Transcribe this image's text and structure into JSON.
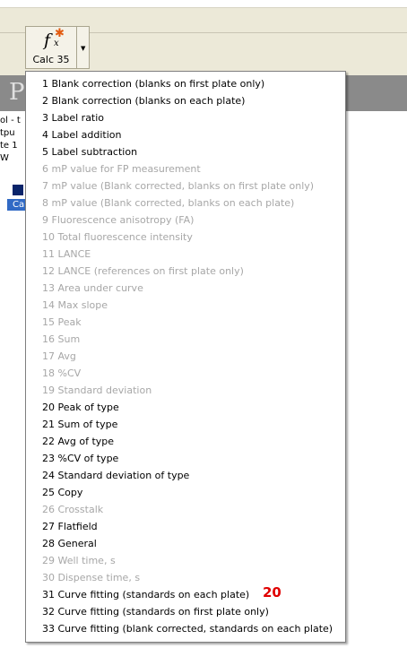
{
  "toolbar": {
    "calc_button_label": "Calc 35"
  },
  "background_window": {
    "header_letter": "P",
    "lines": [
      "ol - t",
      "tpu",
      "te 1",
      "  W"
    ],
    "selected_row_text": "Ca"
  },
  "menu": {
    "items": [
      {
        "label": "1 Blank correction (blanks on first plate only)",
        "enabled": true
      },
      {
        "label": "2 Blank correction (blanks on each plate)",
        "enabled": true
      },
      {
        "label": "3 Label ratio",
        "enabled": true
      },
      {
        "label": "4 Label addition",
        "enabled": true
      },
      {
        "label": "5 Label subtraction",
        "enabled": true
      },
      {
        "label": "6 mP value for FP measurement",
        "enabled": false
      },
      {
        "label": "7 mP value (Blank corrected, blanks on first plate only)",
        "enabled": false
      },
      {
        "label": "8 mP value (Blank corrected, blanks on each plate)",
        "enabled": false
      },
      {
        "label": "9 Fluorescence anisotropy (FA)",
        "enabled": false
      },
      {
        "label": "10 Total fluorescence intensity",
        "enabled": false
      },
      {
        "label": "11 LANCE",
        "enabled": false
      },
      {
        "label": "12 LANCE (references on first plate only)",
        "enabled": false
      },
      {
        "label": "13 Area under curve",
        "enabled": false
      },
      {
        "label": "14 Max slope",
        "enabled": false
      },
      {
        "label": "15 Peak",
        "enabled": false
      },
      {
        "label": "16 Sum",
        "enabled": false
      },
      {
        "label": "17 Avg",
        "enabled": false
      },
      {
        "label": "18 %CV",
        "enabled": false
      },
      {
        "label": "19 Standard deviation",
        "enabled": false
      },
      {
        "label": "20 Peak of type",
        "enabled": true
      },
      {
        "label": "21 Sum of type",
        "enabled": true
      },
      {
        "label": "22 Avg of type",
        "enabled": true
      },
      {
        "label": "23 %CV of type",
        "enabled": true
      },
      {
        "label": "24 Standard deviation of type",
        "enabled": true
      },
      {
        "label": "25 Copy",
        "enabled": true
      },
      {
        "label": "26 Crosstalk",
        "enabled": false
      },
      {
        "label": "27 Flatfield",
        "enabled": true
      },
      {
        "label": "28 General",
        "enabled": true
      },
      {
        "label": "29 Well time, s",
        "enabled": false
      },
      {
        "label": "30 Dispense time, s",
        "enabled": false
      },
      {
        "label": "31 Curve fitting (standards on each plate)",
        "enabled": true
      },
      {
        "label": "32 Curve fitting (standards on first plate only)",
        "enabled": true
      },
      {
        "label": "33 Curve fitting (blank corrected, standards on each plate)",
        "enabled": true
      }
    ]
  },
  "annotation": {
    "text": "20",
    "color": "#e00000"
  }
}
